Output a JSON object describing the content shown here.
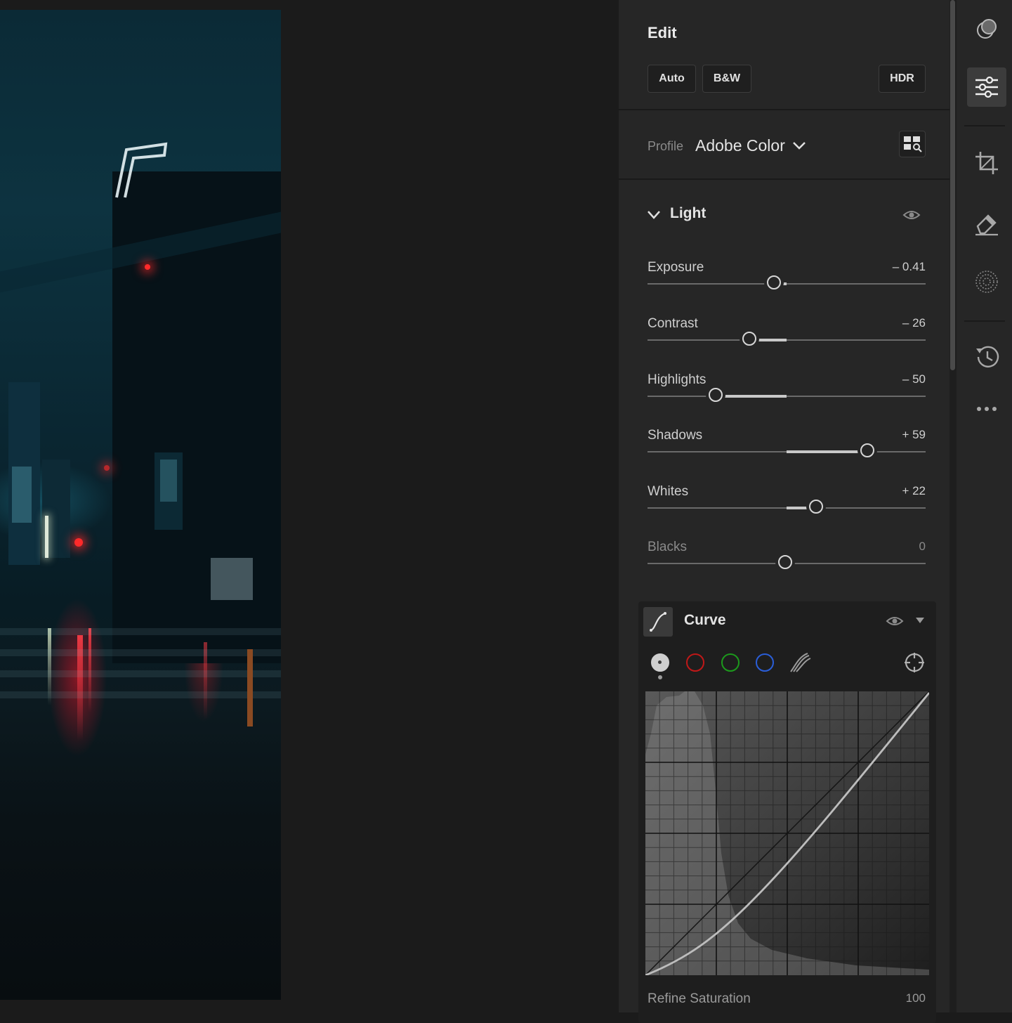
{
  "edit_panel": {
    "title": "Edit",
    "buttons": {
      "auto": "Auto",
      "bw": "B&W",
      "hdr": "HDR"
    },
    "profile": {
      "label": "Profile",
      "value": "Adobe Color"
    }
  },
  "light": {
    "title": "Light",
    "sliders": [
      {
        "label": "Exposure",
        "display": "– 0.41",
        "value": -0.41,
        "min": -5,
        "max": 5,
        "dim": false
      },
      {
        "label": "Contrast",
        "display": "– 26",
        "value": -26,
        "min": -100,
        "max": 100,
        "dim": false
      },
      {
        "label": "Highlights",
        "display": "– 50",
        "value": -50,
        "min": -100,
        "max": 100,
        "dim": false
      },
      {
        "label": "Shadows",
        "display": "+ 59",
        "value": 59,
        "min": -100,
        "max": 100,
        "dim": false
      },
      {
        "label": "Whites",
        "display": "+ 22",
        "value": 22,
        "min": -100,
        "max": 100,
        "dim": false
      },
      {
        "label": "Blacks",
        "display": "0",
        "value": 0,
        "min": -100,
        "max": 100,
        "dim": true
      }
    ]
  },
  "curve": {
    "title": "Curve",
    "channels": [
      "parametric",
      "red",
      "green",
      "blue",
      "rgb-combined"
    ],
    "channel_colors": {
      "red": "#c01818",
      "green": "#1c9a1c",
      "blue": "#2a5ed8"
    },
    "selected_channel": "parametric",
    "refine_saturation": {
      "label": "Refine Saturation",
      "value": "100"
    }
  },
  "toolbar": {
    "tools": [
      "presets-icon",
      "edit-sliders-icon",
      "crop-icon",
      "healing-eraser-icon",
      "masking-icon",
      "history-icon",
      "more-icon"
    ],
    "active": "edit-sliders-icon"
  }
}
